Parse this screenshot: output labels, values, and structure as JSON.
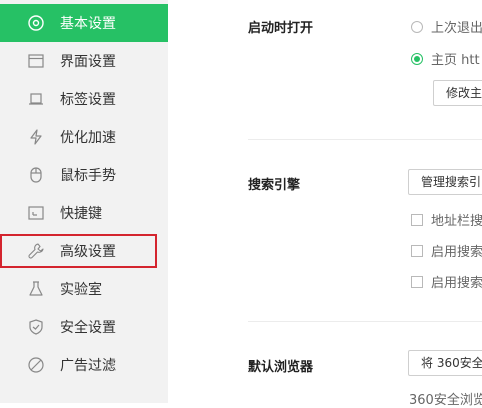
{
  "sidebar": {
    "items": [
      {
        "label": "基本设置",
        "icon": "home-settings-icon"
      },
      {
        "label": "界面设置",
        "icon": "window-icon"
      },
      {
        "label": "标签设置",
        "icon": "tab-icon"
      },
      {
        "label": "优化加速",
        "icon": "lightning-icon"
      },
      {
        "label": "鼠标手势",
        "icon": "mouse-icon"
      },
      {
        "label": "快捷键",
        "icon": "keyboard-icon"
      },
      {
        "label": "高级设置",
        "icon": "wrench-icon"
      },
      {
        "label": "实验室",
        "icon": "flask-icon"
      },
      {
        "label": "安全设置",
        "icon": "shield-icon"
      },
      {
        "label": "广告过滤",
        "icon": "block-icon"
      }
    ],
    "active_index": 0,
    "highlighted_index": 6
  },
  "startup": {
    "title": "启动时打开",
    "option_last": "上次退出",
    "option_home": "主页 htt",
    "modify_button": "修改主"
  },
  "search": {
    "title": "搜索引擎",
    "manage_button": "管理搜索引",
    "check_addressbar": "地址栏搜",
    "check_enable1": "启用搜索",
    "check_enable2": "启用搜索"
  },
  "default_browser": {
    "title": "默认浏览器",
    "set_button": "将 360安全",
    "status_text": "360安全浏览"
  },
  "colors": {
    "accent": "#26c165",
    "highlight": "#d4242e",
    "sidebar_bg": "#f2f2f2"
  }
}
